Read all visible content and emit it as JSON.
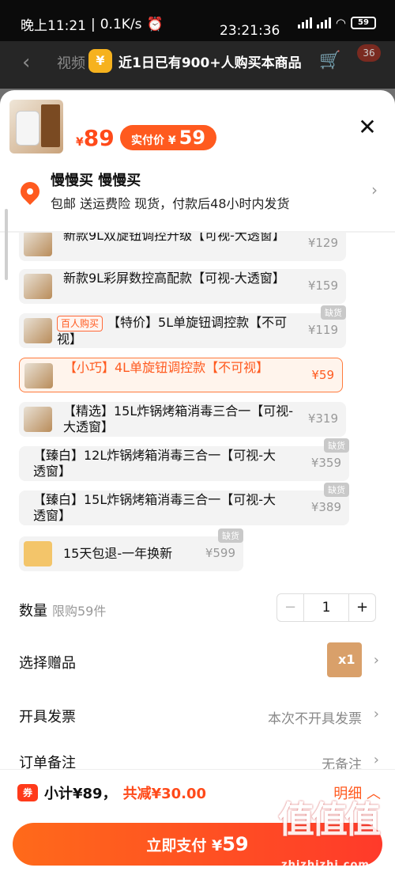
{
  "status_bar": {
    "time_left": "晚上11:21",
    "net_speed": "0.1K/s",
    "time_center": "23:21:36",
    "battery": "59"
  },
  "under_header": {
    "title": "视频",
    "cart_badge": "36"
  },
  "promo_banner": {
    "prefix": "近",
    "days": "1",
    "middle": "日已有",
    "count": "900+",
    "suffix": "人购买本商品"
  },
  "product": {
    "currency": "¥",
    "original_price": "89",
    "pay_label": "实付价 ¥",
    "pay_price": "59"
  },
  "address": {
    "name": "慢慢买 慢慢买",
    "description": "包邮 送运费险 现货，付款后48小时内发货"
  },
  "options": [
    {
      "label": "新款9L双旋钮调控升级【可视-大透窗】",
      "price": "¥129",
      "tag": "",
      "hot": "",
      "selected": false
    },
    {
      "label": "新款9L彩屏数控高配款【可视-大透窗】",
      "price": "¥159",
      "tag": "",
      "hot": "",
      "selected": false
    },
    {
      "label": "【特价】5L单旋钮调控款【不可视】",
      "price": "¥119",
      "tag": "缺货",
      "hot": "百人购买",
      "selected": false
    },
    {
      "label": "【小巧】4L单旋钮调控款【不可视】",
      "price": "¥59",
      "tag": "",
      "hot": "",
      "selected": true
    },
    {
      "label": "【精选】15L炸锅烤箱消毒三合一【可视-大透窗】",
      "price": "¥319",
      "tag": "",
      "hot": "",
      "selected": false
    },
    {
      "label": "【臻白】12L炸锅烤箱消毒三合一【可视-大透窗】",
      "price": "¥359",
      "tag": "缺货",
      "hot": "",
      "selected": false
    },
    {
      "label": "【臻白】15L炸锅烤箱消毒三合一【可视-大透窗】",
      "price": "¥389",
      "tag": "缺货",
      "hot": "",
      "selected": false
    },
    {
      "label": "15天包退-一年换新",
      "price": "¥599",
      "tag": "缺货",
      "hot": "",
      "selected": false
    }
  ],
  "quantity": {
    "label": "数量",
    "limit": "限购59件",
    "minus": "−",
    "value": "1",
    "plus": "+"
  },
  "gift": {
    "label": "选择赠品",
    "count": "x1"
  },
  "invoice": {
    "label": "开具发票",
    "value": "本次不开具发票"
  },
  "remark": {
    "label": "订单备注",
    "value": "无备注"
  },
  "footer": {
    "subtotal": "小计¥89，",
    "discount": "共减¥30.00",
    "detail": "明细",
    "pay_label": "立即支付 ¥",
    "pay_amount": "59"
  },
  "watermark": {
    "big": "值值值",
    "small": "zhizhizhi.com"
  }
}
